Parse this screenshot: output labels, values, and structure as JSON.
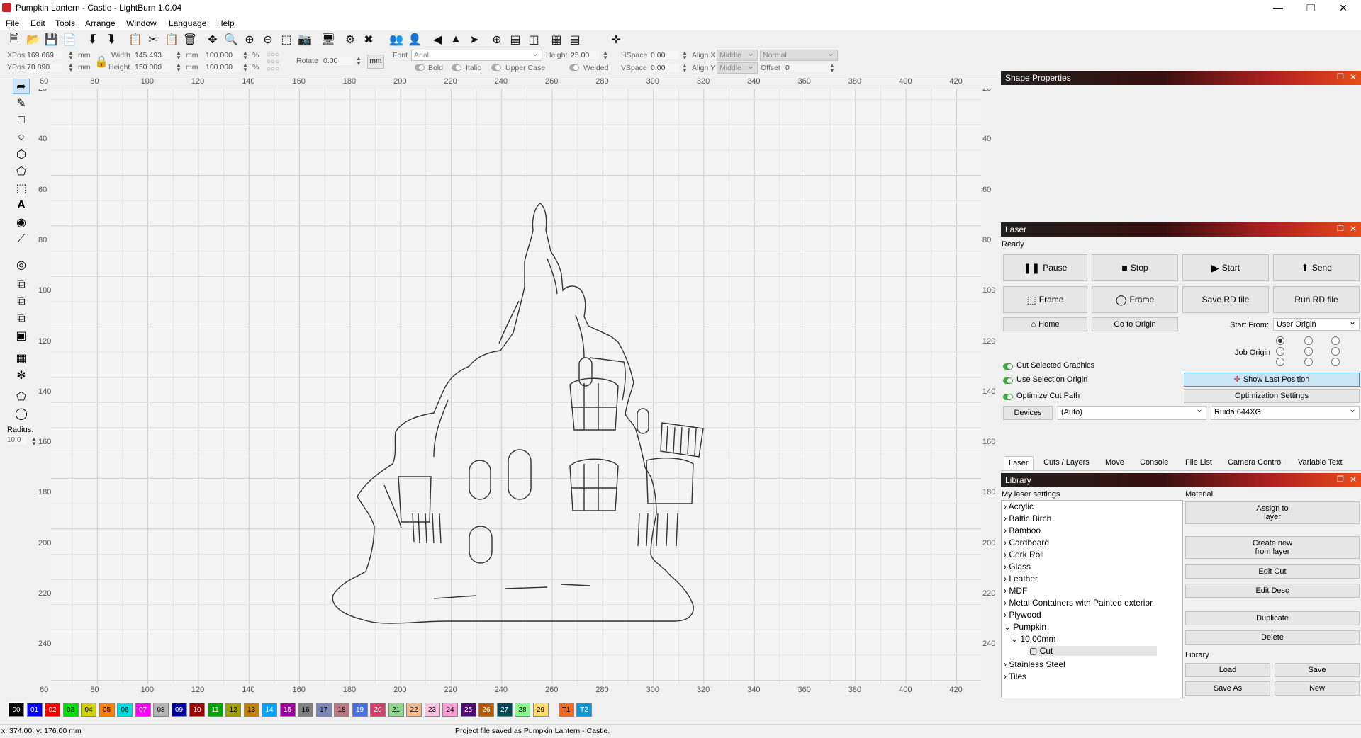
{
  "window": {
    "title": "Pumpkin Lantern - Castle - LightBurn 1.0.04"
  },
  "menu": [
    "File",
    "Edit",
    "Tools",
    "Arrange",
    "Window",
    "Language",
    "Help"
  ],
  "props": {
    "xpos_label": "XPos",
    "xpos": "169.669",
    "ypos_label": "YPos",
    "ypos": "70.890",
    "unit": "mm",
    "width_label": "Width",
    "width": "145.493",
    "height_label": "Height",
    "height": "150.000",
    "scale_x": "100.000",
    "scale_y": "100.000",
    "pct": "%",
    "rotate_label": "Rotate",
    "rotate": "0.00",
    "mm_btn": "mm",
    "font_label": "Font",
    "font": "Arial",
    "fheight_label": "Height",
    "fheight": "25.00",
    "hspace_label": "HSpace",
    "hspace": "0.00",
    "vspace_label": "VSpace",
    "vspace": "0.00",
    "alignx_label": "Align X",
    "alignx": "Middle",
    "aligny_label": "Align Y",
    "aligny": "Middle",
    "normal": "Normal",
    "offset_label": "Offset",
    "offset": "0",
    "bold": "Bold",
    "italic": "Italic",
    "upper": "Upper Case",
    "welded": "Welded"
  },
  "left": {
    "radius_label": "Radius:",
    "radius": "10.0"
  },
  "ruler": {
    "x": [
      "60",
      "80",
      "100",
      "120",
      "140",
      "160",
      "180",
      "200",
      "220",
      "240",
      "260",
      "280",
      "300",
      "320",
      "340",
      "360",
      "380",
      "400",
      "420"
    ],
    "y": [
      "20",
      "40",
      "60",
      "80",
      "100",
      "120",
      "140",
      "160",
      "180",
      "200",
      "220",
      "240"
    ]
  },
  "shape_panel": {
    "title": "Shape Properties"
  },
  "laser": {
    "title": "Laser",
    "status": "Ready",
    "pause": "Pause",
    "stop": "Stop",
    "start": "Start",
    "send": "Send",
    "frame1": "Frame",
    "frame2": "Frame",
    "save_rd": "Save RD file",
    "run_rd": "Run RD file",
    "home": "Home",
    "go_origin": "Go to Origin",
    "start_from_label": "Start From:",
    "start_from": "User Origin",
    "job_origin": "Job Origin",
    "cut_selected": "Cut Selected Graphics",
    "use_sel_origin": "Use Selection Origin",
    "optimize": "Optimize Cut Path",
    "show_last": "Show Last Position",
    "opt_settings": "Optimization Settings",
    "devices": "Devices",
    "auto": "(Auto)",
    "device": "Ruida 644XG"
  },
  "tabs": [
    "Laser",
    "Cuts / Layers",
    "Move",
    "Console",
    "File List",
    "Camera Control",
    "Variable Text"
  ],
  "library": {
    "title": "Library",
    "my_settings": "My laser settings",
    "material": "Material",
    "items": [
      "Acrylic",
      "Baltic Birch",
      "Bamboo",
      "Cardboard",
      "Cork Roll",
      "Glass",
      "Leather",
      "MDF",
      "Metal Containers with Painted exterior",
      "Plywood",
      "Pumpkin"
    ],
    "sub": "10.00mm",
    "cut": "Cut",
    "after": [
      "Stainless Steel",
      "Tiles"
    ],
    "assign": "Assign to\nlayer",
    "create": "Create new\nfrom layer",
    "edit_cut": "Edit Cut",
    "edit_desc": "Edit Desc",
    "duplicate": "Duplicate",
    "delete": "Delete",
    "lib_label": "Library",
    "load": "Load",
    "save": "Save",
    "save_as": "Save As",
    "new": "New"
  },
  "palette": [
    {
      "l": "00",
      "c": "#000000",
      "t": "#fff"
    },
    {
      "l": "01",
      "c": "#0000ff",
      "t": "#fff"
    },
    {
      "l": "02",
      "c": "#ff0000",
      "t": "#fff"
    },
    {
      "l": "03",
      "c": "#00e000",
      "t": "#000"
    },
    {
      "l": "04",
      "c": "#d0d000",
      "t": "#000"
    },
    {
      "l": "05",
      "c": "#ff8000",
      "t": "#000"
    },
    {
      "l": "06",
      "c": "#00e0e0",
      "t": "#000"
    },
    {
      "l": "07",
      "c": "#ff00ff",
      "t": "#fff"
    },
    {
      "l": "08",
      "c": "#b4b4b4",
      "t": "#000"
    },
    {
      "l": "09",
      "c": "#0000a0",
      "t": "#fff"
    },
    {
      "l": "10",
      "c": "#a00000",
      "t": "#fff"
    },
    {
      "l": "11",
      "c": "#00a000",
      "t": "#fff"
    },
    {
      "l": "12",
      "c": "#a0a000",
      "t": "#000"
    },
    {
      "l": "13",
      "c": "#c08000",
      "t": "#000"
    },
    {
      "l": "14",
      "c": "#00a0ff",
      "t": "#fff"
    },
    {
      "l": "15",
      "c": "#a000a0",
      "t": "#fff"
    },
    {
      "l": "16",
      "c": "#808080",
      "t": "#000"
    },
    {
      "l": "17",
      "c": "#7d87b9",
      "t": "#000"
    },
    {
      "l": "18",
      "c": "#bb7784",
      "t": "#000"
    },
    {
      "l": "19",
      "c": "#4a6fe3",
      "t": "#fff"
    },
    {
      "l": "20",
      "c": "#d33f6a",
      "t": "#fff"
    },
    {
      "l": "21",
      "c": "#8cd78c",
      "t": "#000"
    },
    {
      "l": "22",
      "c": "#f0b98d",
      "t": "#000"
    },
    {
      "l": "23",
      "c": "#f6c4e1",
      "t": "#000"
    },
    {
      "l": "24",
      "c": "#fa9ed4",
      "t": "#000"
    },
    {
      "l": "25",
      "c": "#500a78",
      "t": "#fff"
    },
    {
      "l": "26",
      "c": "#b45a00",
      "t": "#fff"
    },
    {
      "l": "27",
      "c": "#004754",
      "t": "#fff"
    },
    {
      "l": "28",
      "c": "#86fa88",
      "t": "#000"
    },
    {
      "l": "29",
      "c": "#ffdb66",
      "t": "#000"
    },
    {
      "l": "T1",
      "c": "#f36926",
      "t": "#000"
    },
    {
      "l": "T2",
      "c": "#0c96d9",
      "t": "#fff"
    }
  ],
  "status": {
    "coords": "x: 374.00, y: 176.00 mm",
    "message": "Project file saved as Pumpkin Lantern - Castle."
  }
}
